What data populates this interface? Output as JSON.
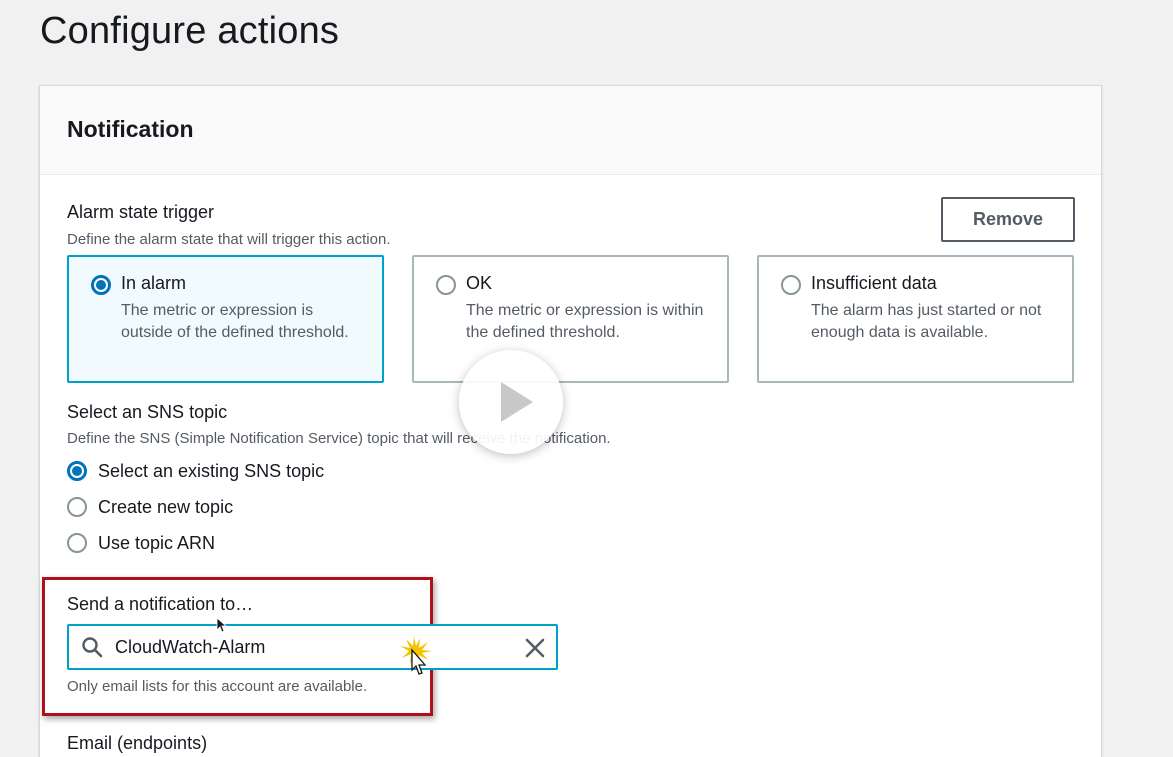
{
  "page": {
    "title": "Configure actions"
  },
  "notification": {
    "header": "Notification",
    "remove_label": "Remove",
    "trigger": {
      "label": "Alarm state trigger",
      "description": "Define the alarm state that will trigger this action.",
      "options": [
        {
          "title": "In alarm",
          "description": "The metric or expression is outside of the defined threshold.",
          "selected": true
        },
        {
          "title": "OK",
          "description": "The metric or expression is within the defined threshold.",
          "selected": false
        },
        {
          "title": "Insufficient data",
          "description": "The alarm has just started or not enough data is available.",
          "selected": false
        }
      ]
    },
    "sns": {
      "label": "Select an SNS topic",
      "description": "Define the SNS (Simple Notification Service) topic that will receive the notification.",
      "options": [
        {
          "label": "Select an existing SNS topic",
          "selected": true
        },
        {
          "label": "Create new topic",
          "selected": false
        },
        {
          "label": "Use topic ARN",
          "selected": false
        }
      ]
    },
    "send_to": {
      "label": "Send a notification to…",
      "value": "CloudWatch-Alarm",
      "hint": "Only email lists for this account are available."
    },
    "email_label": "Email (endpoints)"
  },
  "colors": {
    "accent": "#0073bb",
    "selected_border": "#00a1c9",
    "highlight": "#b0101a"
  },
  "icons": {
    "search": "search-icon",
    "clear": "close-icon",
    "play": "play-icon",
    "cursor": "pointer-cursor-icon"
  }
}
